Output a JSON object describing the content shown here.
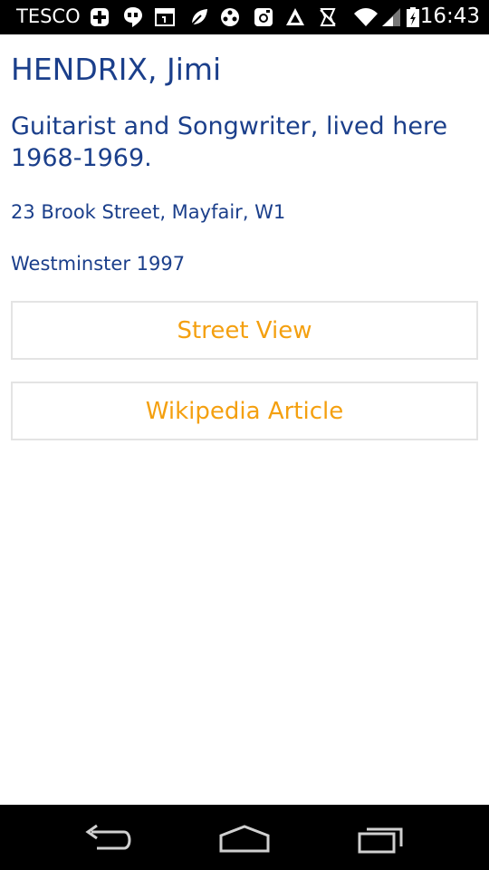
{
  "status_bar": {
    "carrier": "TESCO",
    "time": "16:43",
    "icons": [
      "add-icon",
      "hangouts-icon",
      "calendar-icon",
      "leaf-icon",
      "media-icon",
      "instagram-icon",
      "tree-icon",
      "silent-icon",
      "wifi-icon",
      "signal-icon",
      "battery-icon"
    ]
  },
  "plaque": {
    "name": "HENDRIX, Jimi",
    "description": "Guitarist and Songwriter, lived here 1968-1969.",
    "address": "23 Brook Street, Mayfair, W1",
    "erected": "Westminster 1997"
  },
  "actions": {
    "street_view": "Street View",
    "wikipedia": "Wikipedia Article"
  },
  "nav": {
    "icons": [
      "back-icon",
      "home-icon",
      "recents-icon"
    ]
  },
  "colors": {
    "text_primary": "#1b3f8b",
    "button_text": "#f4a010",
    "button_border": "#e4e4e4"
  }
}
